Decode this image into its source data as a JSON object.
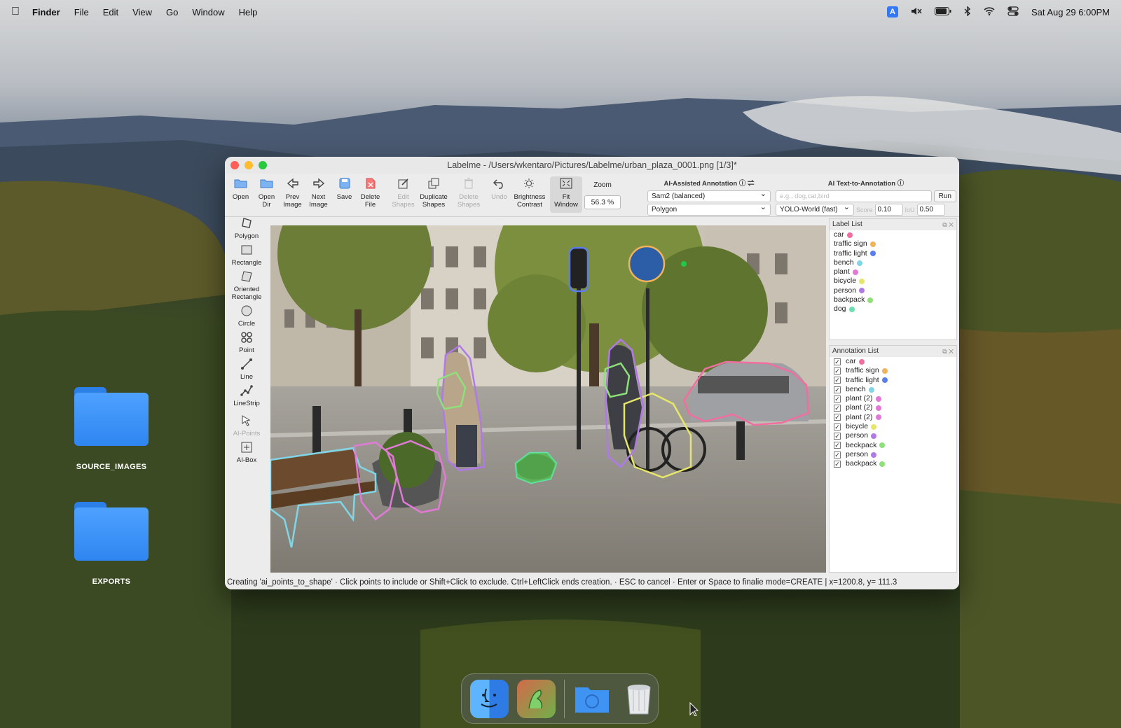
{
  "menubar": {
    "items": [
      "Finder",
      "File",
      "Edit",
      "View",
      "Go",
      "Window",
      "Help"
    ],
    "status_input": "A",
    "datetime": "Sat Aug 29  6:00PM"
  },
  "desktop": {
    "folders": [
      "SOURCE_IMAGES",
      "EXPORTS"
    ]
  },
  "window": {
    "title": "Labelme - /Users/wkentaro/Pictures/Labelme/urban_plaza_0001.png [1/3]*",
    "toolbar": {
      "open": "Open",
      "open_dir_1": "Open",
      "open_dir_2": "Dir",
      "prev_1": "Prev",
      "prev_2": "Image",
      "next_1": "Next",
      "next_2": "Image",
      "save": "Save",
      "delete_1": "Delete",
      "delete_2": "File",
      "edit_1": "Edit",
      "edit_2": "Shapes",
      "dup_1": "Duplicate",
      "dup_2": "Shapes",
      "del_shapes_1": "Delete",
      "del_shapes_2": "Shapes",
      "undo": "Undo",
      "bright_1": "Brightness",
      "bright_2": "Contrast",
      "fit_1": "Fit",
      "fit_2": "Window",
      "zoom_label": "Zoom",
      "zoom_value": "56.3 %"
    },
    "ai_assist": {
      "header": "AI-Assisted Annotation",
      "model": "Sam2 (balanced)",
      "output": "Polygon"
    },
    "text_to_annotation": {
      "header": "AI Text-to-Annotation",
      "placeholder": "e.g., dog,cat,bird",
      "run": "Run",
      "model": "YOLO-World (fast)",
      "score_label": "Score",
      "score": "0.10",
      "iou_label": "IoU",
      "iou": "0.50"
    },
    "tools": {
      "polygon": "Polygon",
      "rectangle": "Rectangle",
      "oriented_1": "Oriented",
      "oriented_2": "Rectangle",
      "circle": "Circle",
      "point": "Point",
      "line": "Line",
      "linestrip": "LineStrip",
      "ai_points": "AI-Points",
      "ai_box": "AI-Box"
    },
    "label_list": {
      "header": "Label List",
      "items": [
        {
          "name": "car",
          "color": "#f06ea0"
        },
        {
          "name": "traffic sign",
          "color": "#f2b25a"
        },
        {
          "name": "traffic light",
          "color": "#5a7ef0"
        },
        {
          "name": "bench",
          "color": "#7fd6e6"
        },
        {
          "name": "plant",
          "color": "#e07ad6"
        },
        {
          "name": "bicycle",
          "color": "#e6e66a"
        },
        {
          "name": "person",
          "color": "#b07ae6"
        },
        {
          "name": "backpack",
          "color": "#8ee07a"
        },
        {
          "name": "dog",
          "color": "#6ae0b0"
        }
      ]
    },
    "annotation_list": {
      "header": "Annotation List",
      "items": [
        {
          "name": "car",
          "color": "#f06ea0"
        },
        {
          "name": "traffic sign",
          "color": "#f2b25a"
        },
        {
          "name": "traffic light",
          "color": "#5a7ef0"
        },
        {
          "name": "bench",
          "color": "#7fd6e6"
        },
        {
          "name": "plant (2)",
          "color": "#e07ad6"
        },
        {
          "name": "plant (2)",
          "color": "#e07ad6"
        },
        {
          "name": "plant (2)",
          "color": "#e07ad6"
        },
        {
          "name": "bicycle",
          "color": "#e6e66a"
        },
        {
          "name": "person",
          "color": "#b07ae6"
        },
        {
          "name": "beckpack",
          "color": "#8ee07a"
        },
        {
          "name": "person",
          "color": "#b07ae6"
        },
        {
          "name": "backpack",
          "color": "#8ee07a"
        }
      ]
    },
    "status": "Creating 'ai_points_to_shape' · Click points to include or Shift+Click to exclude. Ctrl+LeftClick ends creation. · ESC to cancel · Enter or Space to finalie mode=CREATE  |  x=1200.8, y= 111.3"
  },
  "colors": {
    "accent": "#3478f6",
    "close": "#ff5f57",
    "minimize": "#febc2e",
    "zoom": "#28c840"
  },
  "icons": [
    "apple-icon",
    "mute-icon",
    "battery-icon",
    "bluetooth-icon",
    "wifi-icon",
    "control-center-icon",
    "finder-icon",
    "labelme-icon",
    "downloads-folder-icon",
    "trash-icon"
  ]
}
